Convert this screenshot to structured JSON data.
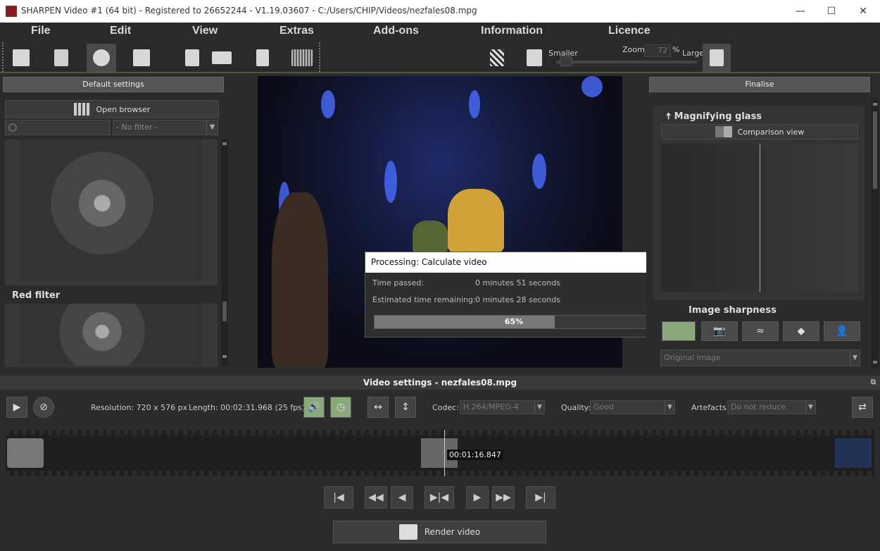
{
  "window": {
    "title": "SHARPEN Video #1 (64 bit) - Registered to 26652244 - V1.19.03607 - C:/Users/CHIP/Videos/nezfales08.mpg"
  },
  "menu": [
    "File",
    "Edit",
    "View",
    "Extras",
    "Add-ons",
    "Information",
    "Licence"
  ],
  "toolbar": {
    "zoom_label": "Zoom",
    "zoom_value": "72",
    "zoom_unit": "%",
    "smaller_label": "Smaller",
    "larger_label": "Larger"
  },
  "left_panel": {
    "header": "Default settings",
    "open_browser": "Open browser",
    "filter_placeholder": "- No filter -",
    "red_filter": "Red filter"
  },
  "right_panel": {
    "header": "Finalise",
    "magnifying_title": "Magnifying glass",
    "comparison_view": "Comparison view",
    "image_sharpness": "Image sharpness",
    "original_image": "Original image"
  },
  "dialog": {
    "title": "Processing: Calculate video",
    "time_passed_label": "Time passed:",
    "time_passed_value": "0 minutes 51 seconds",
    "remaining_label": "Estimated time remaining:",
    "remaining_value": "0 minutes 28 seconds",
    "progress": 65,
    "progress_text": "65%"
  },
  "video_settings": {
    "bar_title": "Video settings - nezfales08.mpg",
    "resolution": "Resolution: 720 x 576 px",
    "length": "Length: 00:02:31.968 (25 fps)",
    "codec_label": "Codec:",
    "codec_value": "H.264/MPEG-4",
    "quality_label": "Quality:",
    "quality_value": "Good",
    "artefacts_label": "Artefacts:",
    "artefacts_value": "Do not reduce"
  },
  "timeline": {
    "timestamp": "00:01:16.847",
    "position": 0.505
  },
  "render_label": "Render video",
  "colors": {
    "background": "#2b2b2b",
    "stop_red": "#c0262a",
    "active_green": "#8aa87a"
  }
}
